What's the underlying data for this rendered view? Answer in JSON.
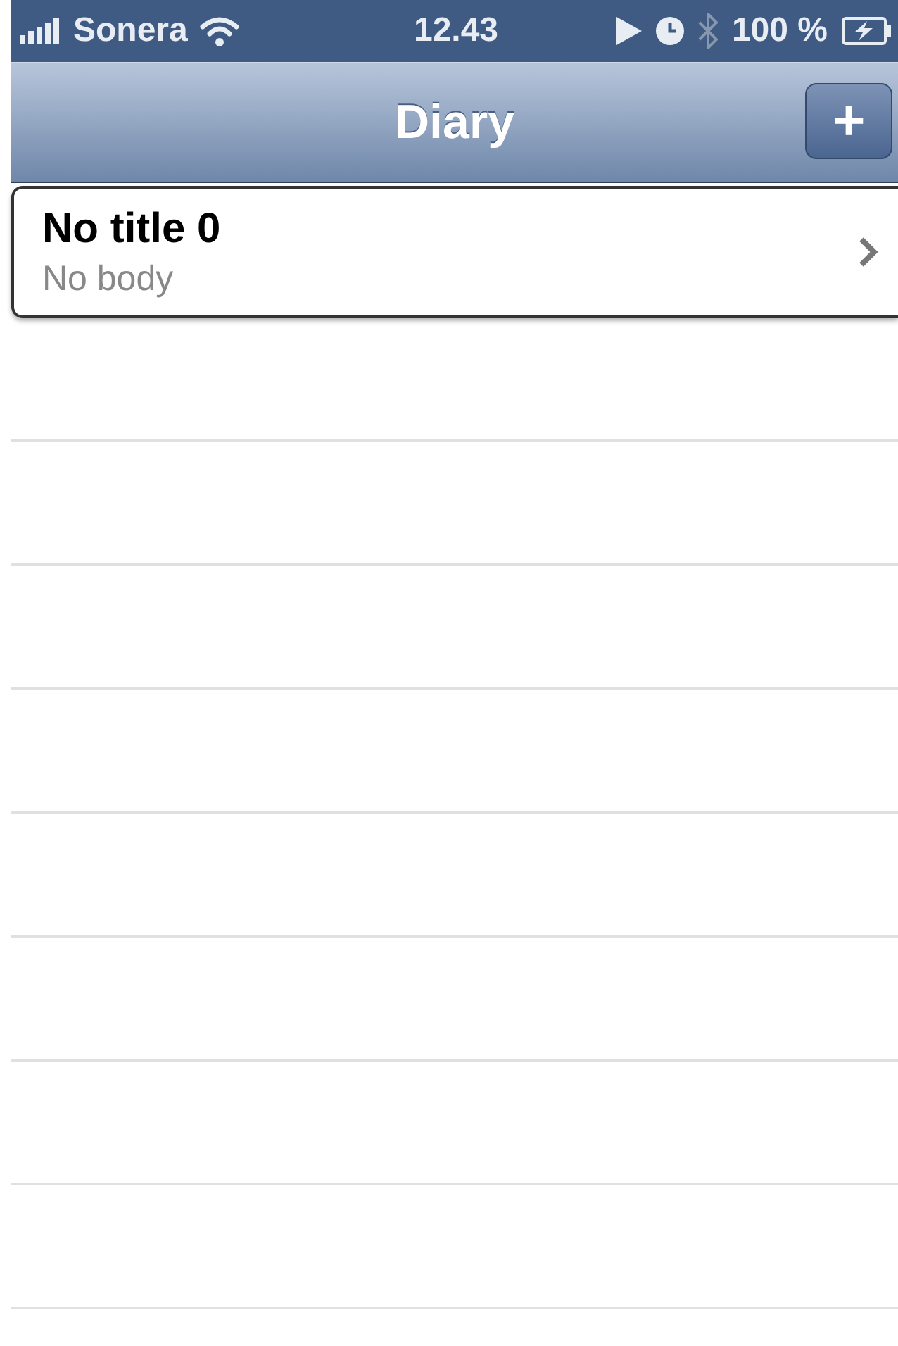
{
  "status_bar": {
    "carrier": "Sonera",
    "time": "12.43",
    "battery": "100 %"
  },
  "nav_bar": {
    "title": "Diary",
    "add_button": "+"
  },
  "entries": [
    {
      "title": "No title 0",
      "body": "No body"
    }
  ]
}
